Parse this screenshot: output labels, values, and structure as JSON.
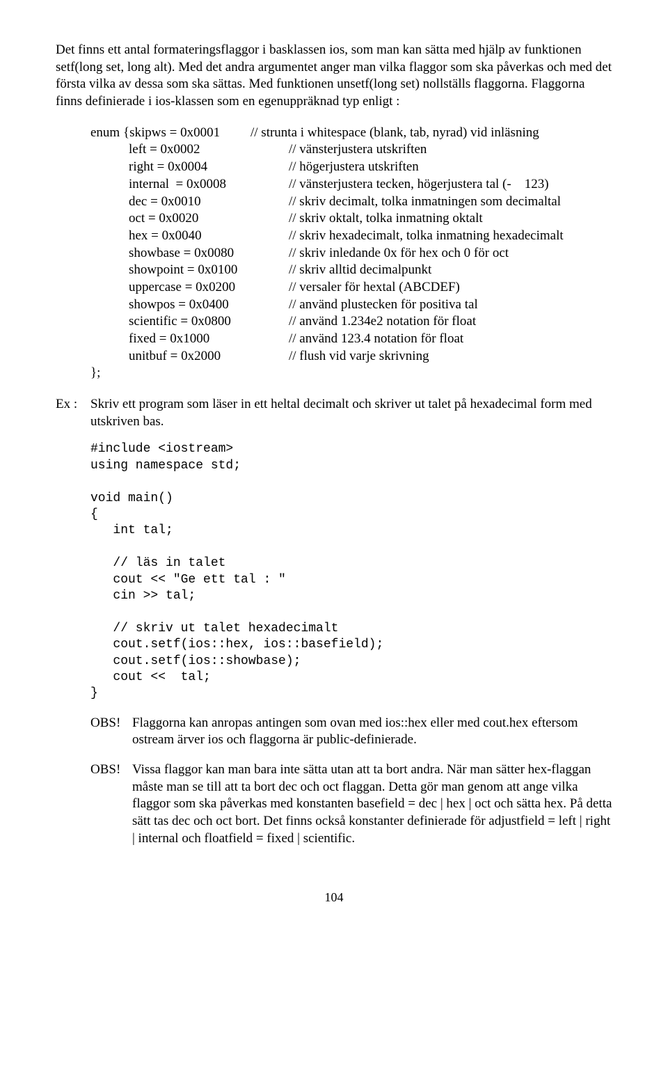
{
  "intro": {
    "p1": "Det finns ett antal formateringsflaggor i basklassen ios, som man kan sätta med hjälp av funktionen setf(long set, long alt). Med det andra argumentet anger man vilka flaggor som ska påverkas och med det första vilka av dessa som ska sättas. Med funktionen unsetf(long set) nollställs flaggorna. Flaggorna finns definierade i ios-klassen som en egenuppräknad typ enligt :"
  },
  "enum_open": "enum {skipws = 0x0001",
  "enum_rows": [
    {
      "l": "left = 0x0002",
      "r": "// vänsterjustera utskriften"
    },
    {
      "l": "right = 0x0004",
      "r": "// högerjustera utskriften"
    },
    {
      "l": "internal  = 0x0008",
      "r": "// vänsterjustera tecken, högerjustera tal (-    123)"
    },
    {
      "l": "dec = 0x0010",
      "r": "// skriv decimalt, tolka inmatningen som decimaltal"
    },
    {
      "l": "oct = 0x0020",
      "r": "// skriv oktalt, tolka inmatning oktalt"
    },
    {
      "l": "hex = 0x0040",
      "r": "// skriv hexadecimalt, tolka inmatning hexadecimalt"
    },
    {
      "l": "showbase = 0x0080",
      "r": "// skriv inledande 0x för hex och 0 för oct"
    },
    {
      "l": "showpoint = 0x0100",
      "r": "// skriv alltid decimalpunkt"
    },
    {
      "l": "uppercase = 0x0200",
      "r": "// versaler för hextal (ABCDEF)"
    },
    {
      "l": "showpos = 0x0400",
      "r": "// använd plustecken för positiva tal"
    },
    {
      "l": "scientific = 0x0800",
      "r": "// använd 1.234e2 notation för float"
    },
    {
      "l": "fixed = 0x1000",
      "r": "// använd 123.4 notation för float"
    },
    {
      "l": "unitbuf = 0x2000",
      "r": "// flush vid varje skrivning"
    }
  ],
  "enum_open_comment": "// strunta i whitespace (blank, tab, nyrad) vid inläsning",
  "enum_close": "};",
  "ex": {
    "label": "Ex :",
    "text": "Skriv ett program som läser in ett heltal decimalt och skriver ut talet på hexadecimal form med utskriven bas."
  },
  "code": "#include <iostream>\nusing namespace std;\n\nvoid main()\n{\n   int tal;\n\n   // läs in talet\n   cout << \"Ge ett tal : \"\n   cin >> tal;\n\n   // skriv ut talet hexadecimalt\n   cout.setf(ios::hex, ios::basefield);\n   cout.setf(ios::showbase);\n   cout <<  tal;\n}",
  "obs1": {
    "label": "OBS!",
    "text": "Flaggorna kan anropas antingen som ovan med ios::hex eller med cout.hex eftersom ostream ärver ios och flaggorna är public-definierade."
  },
  "obs2": {
    "label": "OBS!",
    "text": "Vissa flaggor kan man bara inte sätta utan att ta bort andra. När man sätter hex-flaggan måste man se till att ta bort dec och oct flaggan. Detta gör man genom att ange vilka flaggor som ska påverkas med konstanten basefield = dec | hex | oct och sätta hex. På detta sätt tas dec och oct bort. Det finns också konstanter definierade för adjustfield = left | right | internal och floatfield = fixed | scientific."
  },
  "pagenum": "104"
}
